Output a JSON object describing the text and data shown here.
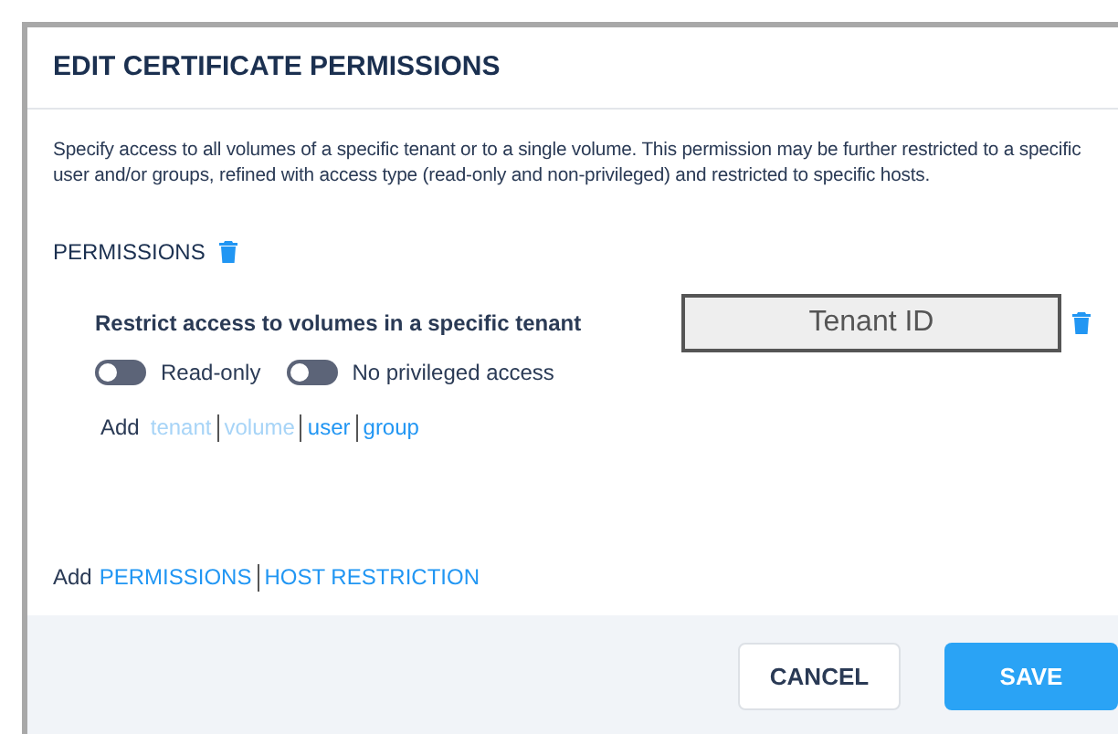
{
  "dialog": {
    "title": "EDIT CERTIFICATE PERMISSIONS",
    "description": "Specify access to all volumes of a specific tenant or to a single volume. This permission may be further restricted to a specific user and/or groups, refined with access type (read-only and non-privileged) and restricted to specific hosts.",
    "permissions": {
      "heading": "PERMISSIONS",
      "restriction": {
        "label": "Restrict access to volumes in a specific tenant",
        "field": {
          "placeholder": "Tenant ID"
        }
      },
      "toggles": [
        {
          "label": "Read-only",
          "on": false
        },
        {
          "label": "No privileged access",
          "on": false
        }
      ],
      "add_label": "Add",
      "add_links": [
        {
          "label": "tenant",
          "disabled": true
        },
        {
          "label": "volume",
          "disabled": true
        },
        {
          "label": "user",
          "disabled": false
        },
        {
          "label": "group",
          "disabled": false
        }
      ]
    },
    "add_label": "Add",
    "add_links": [
      {
        "label": "PERMISSIONS",
        "disabled": false
      },
      {
        "label": "HOST RESTRICTION",
        "disabled": false
      }
    ],
    "buttons": [
      {
        "label": "CANCEL",
        "kind": "secondary"
      },
      {
        "label": "SAVE",
        "kind": "primary"
      }
    ]
  }
}
